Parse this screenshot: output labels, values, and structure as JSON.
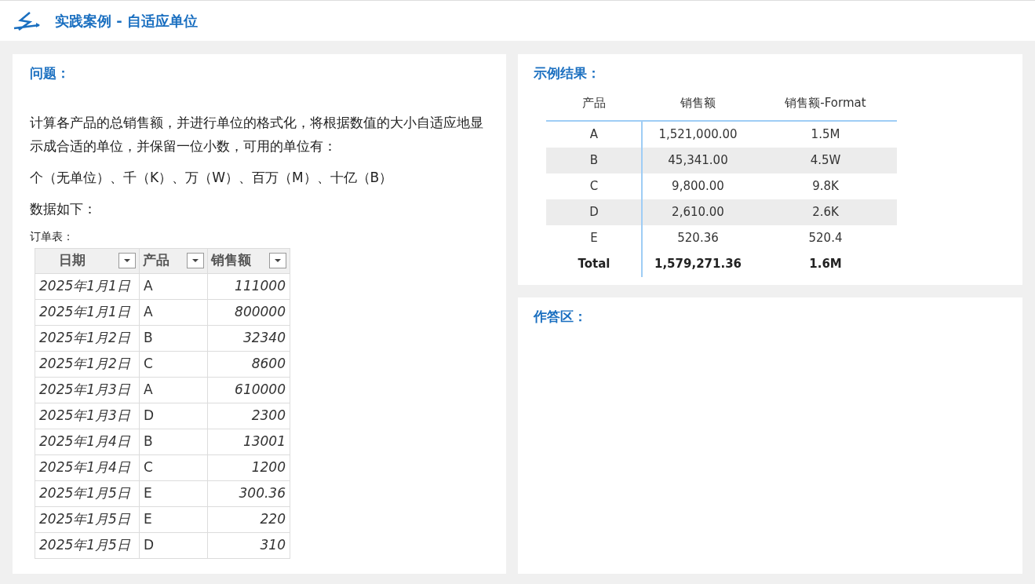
{
  "header": {
    "title": "实践案例 - 自适应单位"
  },
  "problem": {
    "title": "问题：",
    "paragraphs": [
      "计算各产品的总销售额，并进行单位的格式化，将根据数值的大小自适应地显示成合适的单位，并保留一位小数，可用的单位有：",
      "个（无单位）、千（K）、万（W）、百万（M）、十亿（B）",
      "数据如下："
    ],
    "table_caption": "订单表：",
    "table": {
      "columns": [
        "日期",
        "产品",
        "销售额"
      ],
      "rows": [
        [
          "2025年1月1日",
          "A",
          "111000"
        ],
        [
          "2025年1月1日",
          "A",
          "800000"
        ],
        [
          "2025年1月2日",
          "B",
          "32340"
        ],
        [
          "2025年1月2日",
          "C",
          "8600"
        ],
        [
          "2025年1月3日",
          "A",
          "610000"
        ],
        [
          "2025年1月3日",
          "D",
          "2300"
        ],
        [
          "2025年1月4日",
          "B",
          "13001"
        ],
        [
          "2025年1月4日",
          "C",
          "1200"
        ],
        [
          "2025年1月5日",
          "E",
          "300.36"
        ],
        [
          "2025年1月5日",
          "E",
          "220"
        ],
        [
          "2025年1月5日",
          "D",
          "310"
        ]
      ]
    }
  },
  "result": {
    "title": "示例结果：",
    "columns": [
      "产品",
      "销售额",
      "销售额-Format"
    ],
    "rows": [
      {
        "kind": "data",
        "cells": [
          "A",
          "1,521,000.00",
          "1.5M"
        ]
      },
      {
        "kind": "data",
        "cells": [
          "B",
          "45,341.00",
          "4.5W"
        ]
      },
      {
        "kind": "data",
        "cells": [
          "C",
          "9,800.00",
          "9.8K"
        ]
      },
      {
        "kind": "data",
        "cells": [
          "D",
          "2,610.00",
          "2.6K"
        ]
      },
      {
        "kind": "data",
        "cells": [
          "E",
          "520.36",
          "520.4"
        ]
      },
      {
        "kind": "total",
        "cells": [
          "Total",
          "1,579,271.36",
          "1.6M"
        ]
      }
    ]
  },
  "answer": {
    "title": "作答区："
  }
}
